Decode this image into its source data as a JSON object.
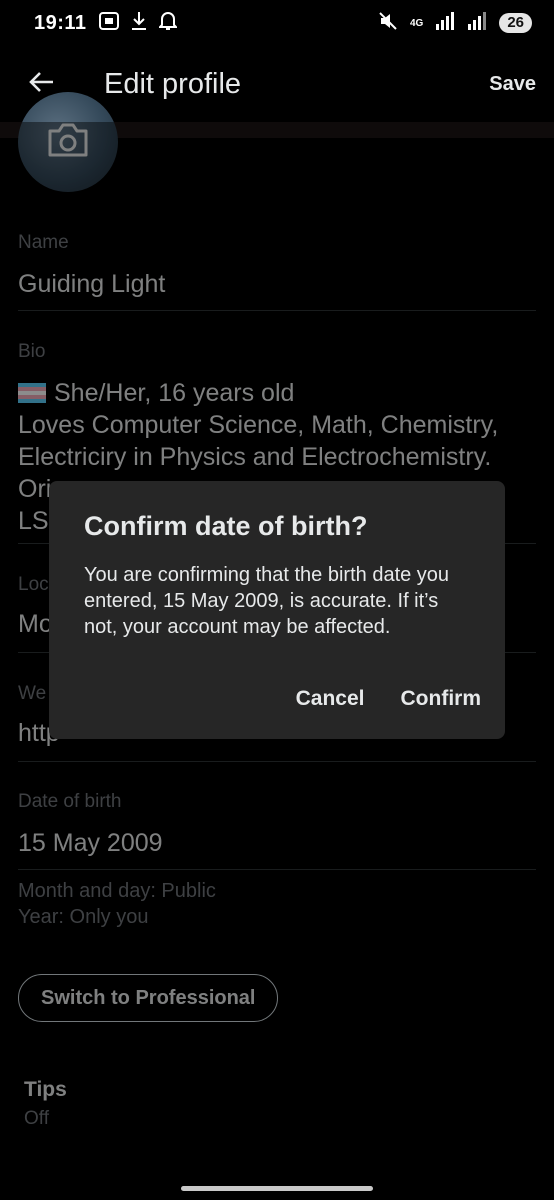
{
  "status_bar": {
    "time": "19:11",
    "network": "4G",
    "battery": "26",
    "icons": [
      "screenshot-icon",
      "download-icon",
      "bell-icon",
      "mute-icon",
      "signal-icon",
      "signal-icon",
      "battery-icon"
    ]
  },
  "app_bar": {
    "title": "Edit profile",
    "save_label": "Save",
    "back_icon": "arrow-left-icon"
  },
  "avatar": {
    "icon": "camera-icon"
  },
  "fields": {
    "name": {
      "label": "Name",
      "value": "Guiding Light"
    },
    "bio": {
      "label": "Bio",
      "lines": [
        "She/Her, 16 years old",
        "Loves Computer Science, Math, Chemistry,",
        "Electriciry in Physics and Electrochemistry.",
        "Ori",
        "LS"
      ]
    },
    "location": {
      "label": "Loc",
      "value": "Mo"
    },
    "website": {
      "label": "We",
      "value": "http"
    },
    "date_of_birth": {
      "label": "Date of birth",
      "value": "15 May 2009"
    }
  },
  "visibility": {
    "month_day": "Month and day: Public",
    "year": "Year: Only you"
  },
  "switch_button": "Switch to Professional",
  "tips": {
    "title": "Tips",
    "value": "Off"
  },
  "dialog": {
    "title": "Confirm date of birth?",
    "body": "You are confirming that the birth date you entered, 15 May 2009, is accurate. If it’s not, your account may be affected.",
    "cancel_label": "Cancel",
    "confirm_label": "Confirm"
  },
  "colors": {
    "background": "#000000",
    "text_primary": "#e7e9ea",
    "text_secondary": "#71767b",
    "divider": "#2f3336",
    "dialog_bg": "#262626"
  }
}
